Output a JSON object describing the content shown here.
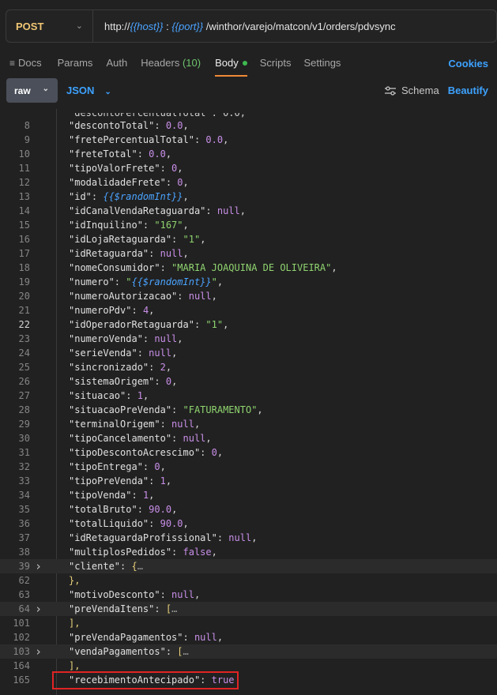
{
  "request": {
    "method": "POST",
    "url_prefix": "http://",
    "host_var": "{{host}}",
    "colon": " : ",
    "port_var": "{{port}}",
    "path": " /winthor/varejo/matcon/v1/orders/pdvsync"
  },
  "tabs": {
    "docs": "Docs",
    "params": "Params",
    "auth": "Auth",
    "headers": "Headers",
    "headers_count": "(10)",
    "body": "Body",
    "scripts": "Scripts",
    "settings": "Settings",
    "cookies": "Cookies"
  },
  "toolbar": {
    "raw": "raw",
    "json": "JSON",
    "schema": "Schema",
    "beautify": "Beautify"
  },
  "editor": {
    "lines": [
      {
        "n": "8",
        "k": "\"descontoTotal\"",
        "v": "0.0",
        "t": "num",
        "c": ","
      },
      {
        "n": "9",
        "k": "\"fretePercentualTotal\"",
        "v": "0.0",
        "t": "num",
        "c": ","
      },
      {
        "n": "10",
        "k": "\"freteTotal\"",
        "v": "0.0",
        "t": "num",
        "c": ","
      },
      {
        "n": "11",
        "k": "\"tipoValorFrete\"",
        "v": "0",
        "t": "num",
        "c": ","
      },
      {
        "n": "12",
        "k": "\"modalidadeFrete\"",
        "v": "0",
        "t": "num",
        "c": ","
      },
      {
        "n": "13",
        "k": "\"id\"",
        "v": "{{$randomInt}}",
        "t": "var",
        "c": ","
      },
      {
        "n": "14",
        "k": "\"idCanalVendaRetaguarda\"",
        "v": "null",
        "t": "kw",
        "c": ","
      },
      {
        "n": "15",
        "k": "\"idInquilino\"",
        "v": "\"167\"",
        "t": "str",
        "c": ","
      },
      {
        "n": "16",
        "k": "\"idLojaRetaguarda\"",
        "v": "\"1\"",
        "t": "str",
        "c": ","
      },
      {
        "n": "17",
        "k": "\"idRetaguarda\"",
        "v": "null",
        "t": "kw",
        "c": ","
      },
      {
        "n": "18",
        "k": "\"nomeConsumidor\"",
        "v": "\"MARIA JOAQUINA DE OLIVEIRA\"",
        "t": "str",
        "c": ","
      },
      {
        "n": "19",
        "k": "\"numero\"",
        "v": "\"{{$randomInt}}\"",
        "t": "strvar",
        "c": ","
      },
      {
        "n": "20",
        "k": "\"numeroAutorizacao\"",
        "v": "null",
        "t": "kw",
        "c": ","
      },
      {
        "n": "21",
        "k": "\"numeroPdv\"",
        "v": "4",
        "t": "num",
        "c": ","
      },
      {
        "n": "22",
        "k": "\"idOperadorRetaguarda\"",
        "v": "\"1\"",
        "t": "str",
        "c": ",",
        "active": true
      },
      {
        "n": "23",
        "k": "\"numeroVenda\"",
        "v": "null",
        "t": "kw",
        "c": ","
      },
      {
        "n": "24",
        "k": "\"serieVenda\"",
        "v": "null",
        "t": "kw",
        "c": ","
      },
      {
        "n": "25",
        "k": "\"sincronizado\"",
        "v": "2",
        "t": "num",
        "c": ","
      },
      {
        "n": "26",
        "k": "\"sistemaOrigem\"",
        "v": "0",
        "t": "num",
        "c": ","
      },
      {
        "n": "27",
        "k": "\"situacao\"",
        "v": "1",
        "t": "num",
        "c": ","
      },
      {
        "n": "28",
        "k": "\"situacaoPreVenda\"",
        "v": "\"FATURAMENTO\"",
        "t": "str",
        "c": ","
      },
      {
        "n": "29",
        "k": "\"terminalOrigem\"",
        "v": "null",
        "t": "kw",
        "c": ","
      },
      {
        "n": "30",
        "k": "\"tipoCancelamento\"",
        "v": "null",
        "t": "kw",
        "c": ","
      },
      {
        "n": "31",
        "k": "\"tipoDescontoAcrescimo\"",
        "v": "0",
        "t": "num",
        "c": ","
      },
      {
        "n": "32",
        "k": "\"tipoEntrega\"",
        "v": "0",
        "t": "num",
        "c": ","
      },
      {
        "n": "33",
        "k": "\"tipoPreVenda\"",
        "v": "1",
        "t": "num",
        "c": ","
      },
      {
        "n": "34",
        "k": "\"tipoVenda\"",
        "v": "1",
        "t": "num",
        "c": ","
      },
      {
        "n": "35",
        "k": "\"totalBruto\"",
        "v": "90.0",
        "t": "num",
        "c": ","
      },
      {
        "n": "36",
        "k": "\"totalLiquido\"",
        "v": "90.0",
        "t": "num",
        "c": ","
      },
      {
        "n": "37",
        "k": "\"idRetaguardaProfissional\"",
        "v": "null",
        "t": "kw",
        "c": ","
      },
      {
        "n": "38",
        "k": "\"multiplosPedidos\"",
        "v": "false",
        "t": "kw",
        "c": ","
      },
      {
        "n": "39",
        "k": "\"cliente\"",
        "v": "{",
        "t": "br",
        "c": "",
        "fold": true,
        "ell": "…",
        "hl": true
      },
      {
        "n": "62",
        "k": "",
        "v": "},",
        "t": "br",
        "c": "",
        "raw": true
      },
      {
        "n": "63",
        "k": "\"motivoDesconto\"",
        "v": "null",
        "t": "kw",
        "c": ","
      },
      {
        "n": "64",
        "k": "\"preVendaItens\"",
        "v": "[",
        "t": "br",
        "c": "",
        "fold": true,
        "ell": "…",
        "hl": true
      },
      {
        "n": "101",
        "k": "",
        "v": "],",
        "t": "br",
        "c": "",
        "raw": true
      },
      {
        "n": "102",
        "k": "\"preVendaPagamentos\"",
        "v": "null",
        "t": "kw",
        "c": ","
      },
      {
        "n": "103",
        "k": "\"vendaPagamentos\"",
        "v": "[",
        "t": "br",
        "c": "",
        "fold": true,
        "ell": "…",
        "hl": true
      },
      {
        "n": "164",
        "k": "",
        "v": "],",
        "t": "br",
        "c": "",
        "raw": true
      },
      {
        "n": "165",
        "k": "\"recebimentoAntecipado\"",
        "v": "true",
        "t": "kw",
        "c": "",
        "boxed": true
      }
    ]
  }
}
